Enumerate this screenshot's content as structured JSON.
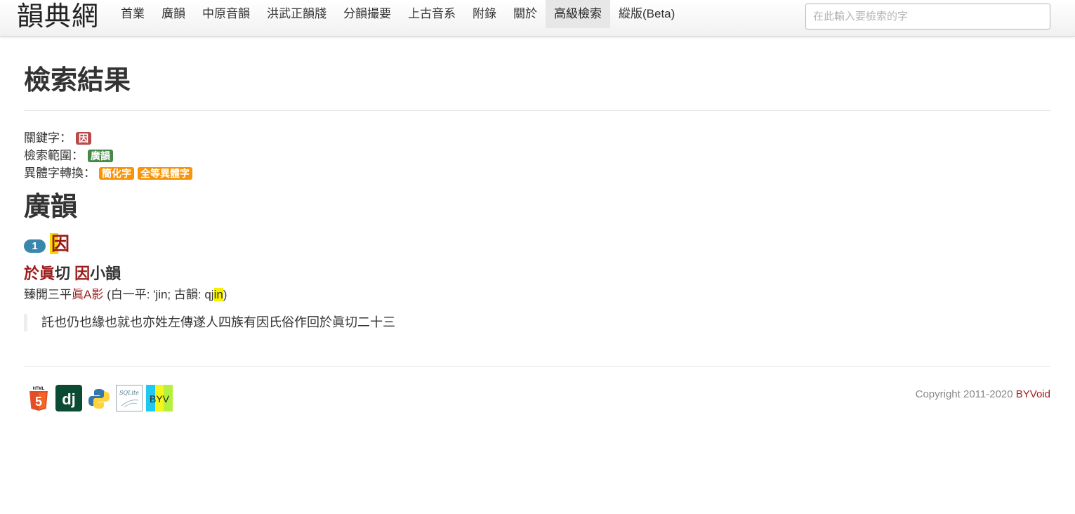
{
  "navbar": {
    "brand": "韻典網",
    "items": [
      "首業",
      "廣韻",
      "中原音韻",
      "洪武正韻牋",
      "分韻撮要",
      "上古音系",
      "附錄",
      "關於",
      "高級檢索",
      "縱版(Beta)"
    ],
    "active_index": 8,
    "search_placeholder": "在此輸入要檢索的字"
  },
  "main": {
    "title": "檢索結果",
    "meta": {
      "keyword_label": "關鍵字：",
      "keyword": "因",
      "scope_label": "檢索範圍：",
      "scope": "廣韻",
      "variant_label": "異體字轉換：",
      "variants": [
        "簡化字",
        "全等異體字"
      ]
    },
    "section_title": "廣韻",
    "entry": {
      "number": "1",
      "char": "因",
      "fanqie_a": "於眞",
      "fanqie_b": "切",
      "small_rhyme_char": "因",
      "small_rhyme_label": "小韻",
      "detail_prefix": "臻開三平",
      "detail_rhyme": "眞A影",
      "detail_open": " (白一平: 'jin; 古韻: qj",
      "detail_hl": "in",
      "detail_close": ")",
      "definition": "託也仍也緣也就也亦姓左傳遂人四族有因氏俗作回於眞切二十三"
    }
  },
  "footer": {
    "icons": [
      "html5-icon",
      "django-icon",
      "python-icon",
      "sqlite-icon",
      "byv-icon"
    ],
    "byv_text": "BYV",
    "sqlite_text": "SQLite",
    "html5_text": "HTML",
    "django_text": "dj",
    "copyright_prefix": "Copyright 2011-2020 ",
    "copyright_link": "BYVoid"
  },
  "colors": {
    "accent_red": "#9b1a1a",
    "label_red": "#b94a48",
    "label_green": "#468847",
    "label_orange": "#f89406",
    "badge_blue": "#3a87ad",
    "highlight": "#f7f000"
  }
}
